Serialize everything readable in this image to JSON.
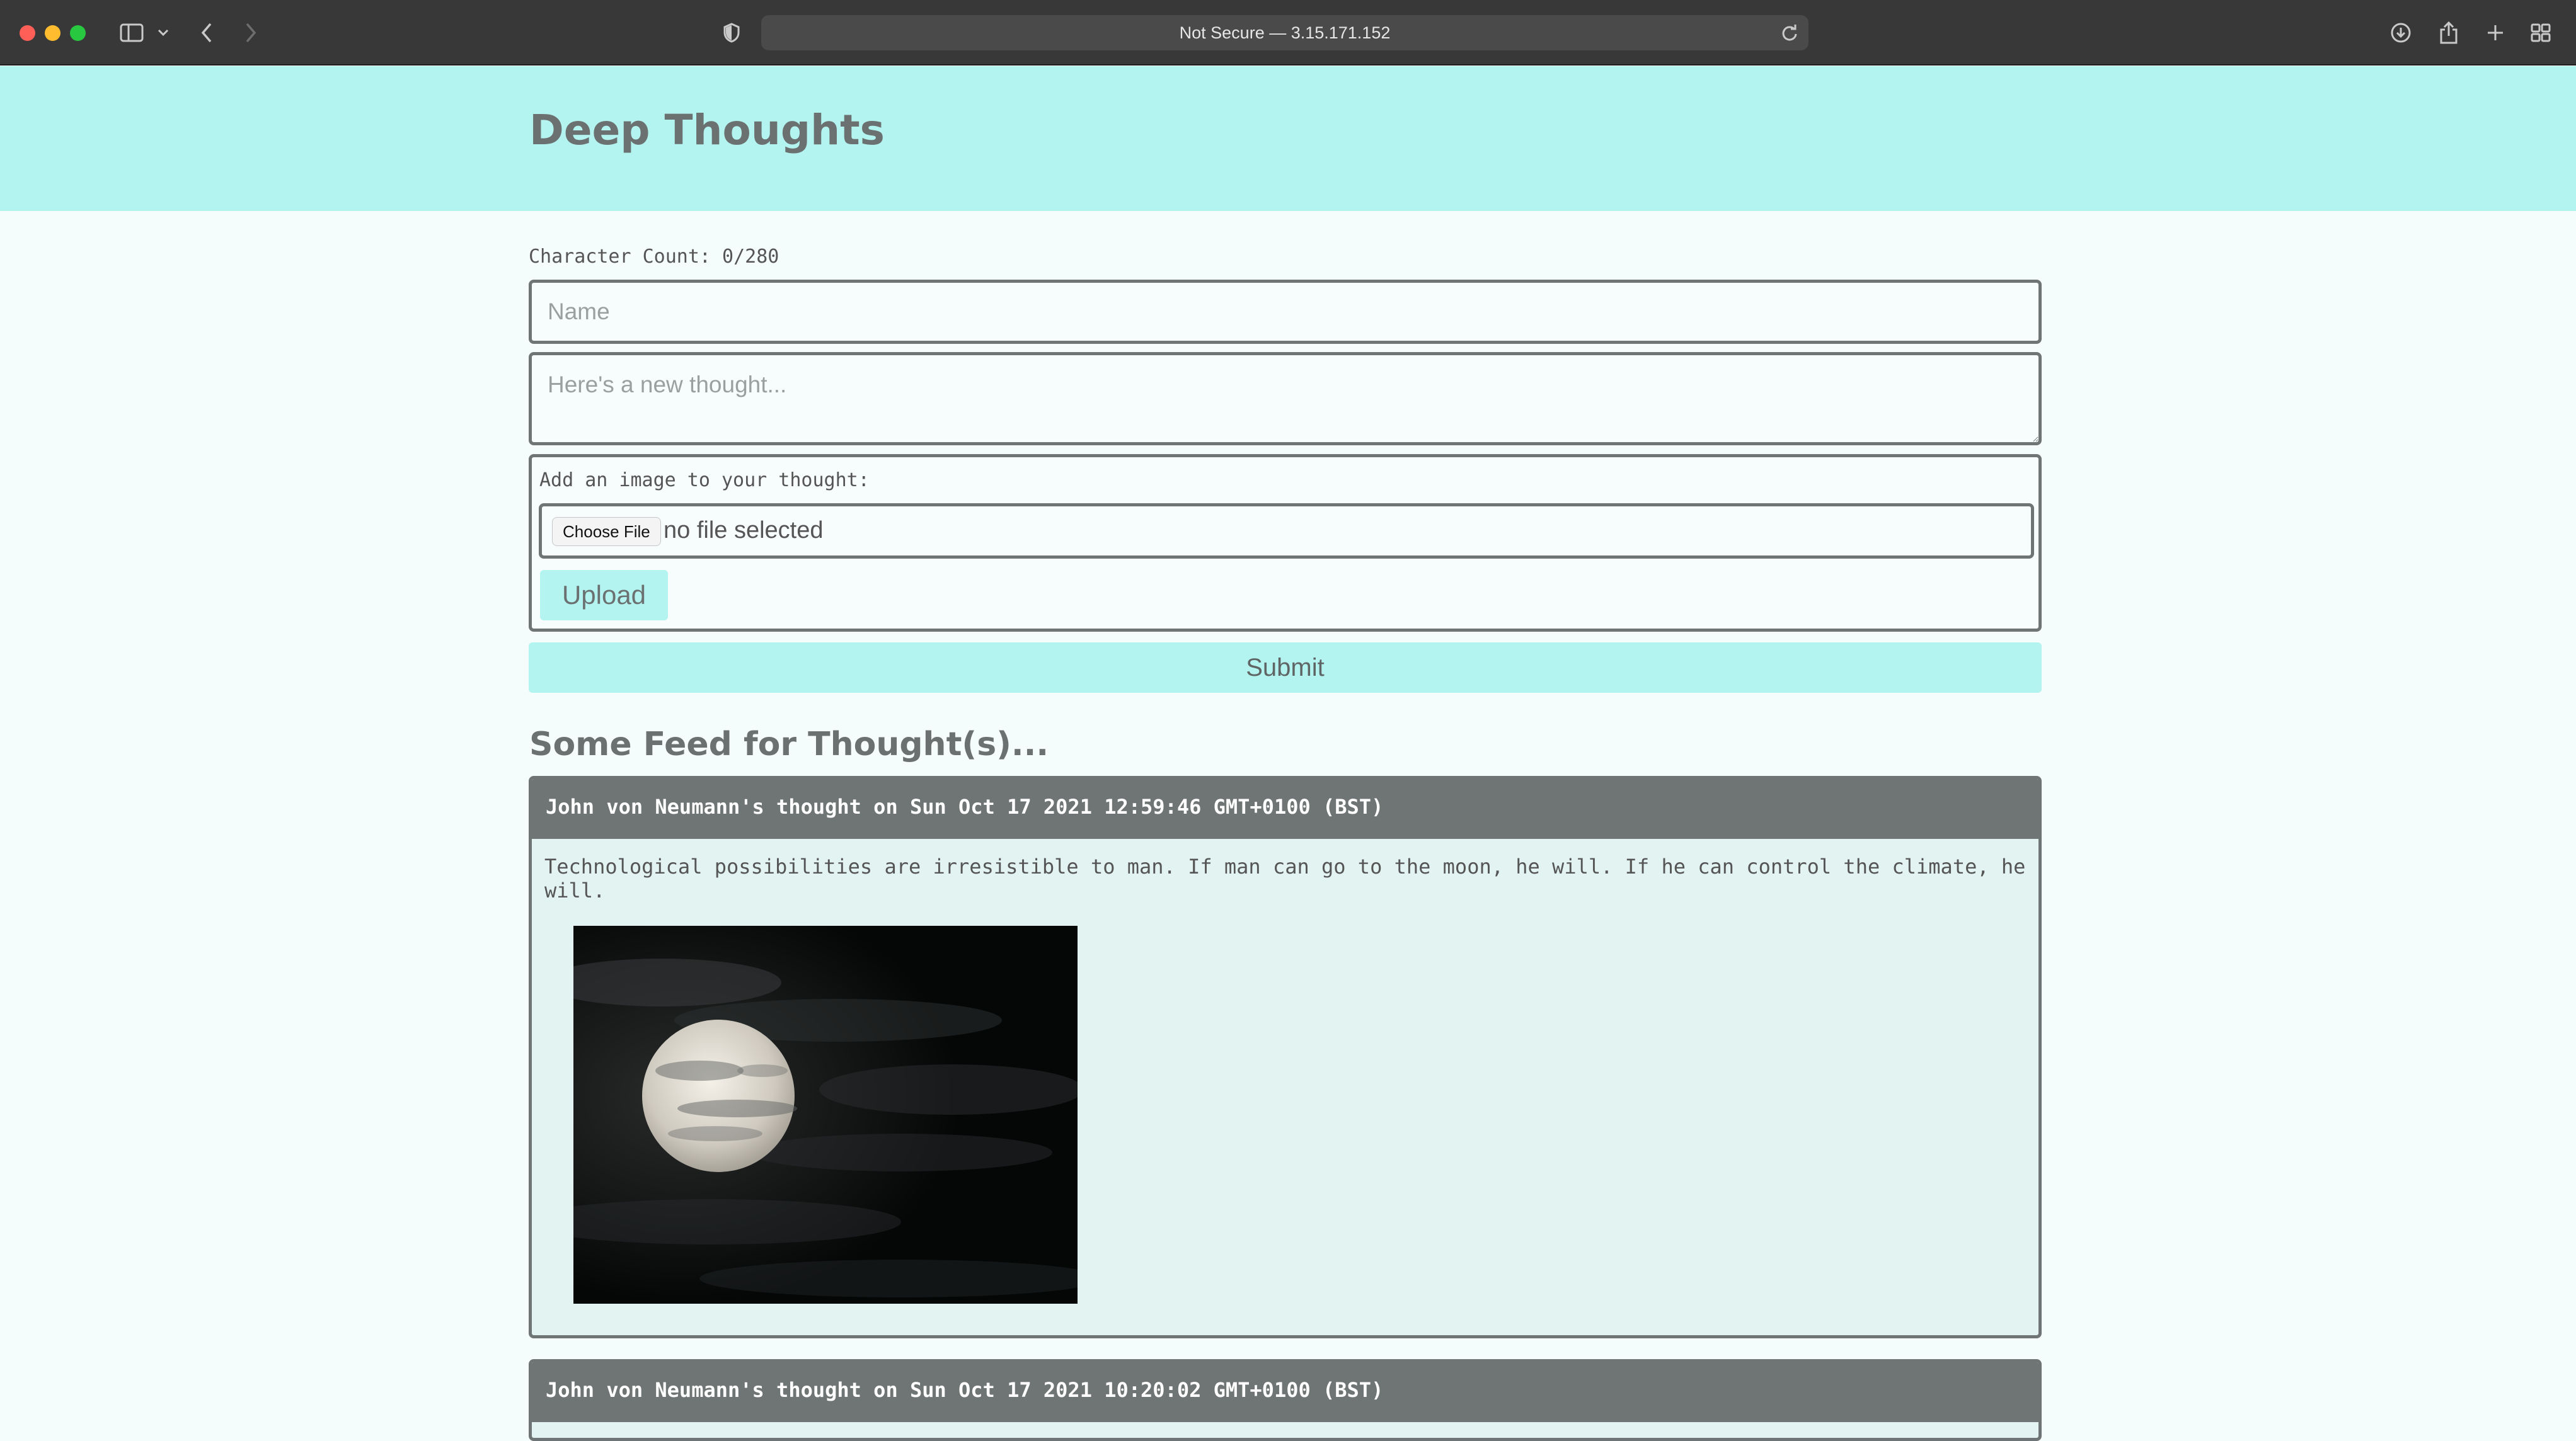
{
  "browser": {
    "address": "Not Secure — 3.15.171.152"
  },
  "header": {
    "title": "Deep Thoughts"
  },
  "form": {
    "char_count": "Character Count: 0/280",
    "name_placeholder": "Name",
    "thought_placeholder": "Here's a new thought...",
    "image_label": "Add an image to your thought:",
    "choose_file_label": "Choose File",
    "file_status": "no file selected",
    "upload_label": "Upload",
    "submit_label": "Submit"
  },
  "feed": {
    "title": "Some Feed for Thought(s)...",
    "thoughts": [
      {
        "heading": "John von Neumann's thought on Sun Oct 17 2021 12:59:46 GMT+0100 (BST)",
        "text": "Technological possibilities are irresistible to man. If man can go to the moon, he will. If he can control the climate, he will."
      },
      {
        "heading": "John von Neumann's thought on Sun Oct 17 2021 10:20:02 GMT+0100 (BST)"
      }
    ]
  },
  "colors": {
    "header_bg": "#b3f3f0",
    "card_header_bg": "#6f7574",
    "page_bg": "#f5fdfc"
  }
}
